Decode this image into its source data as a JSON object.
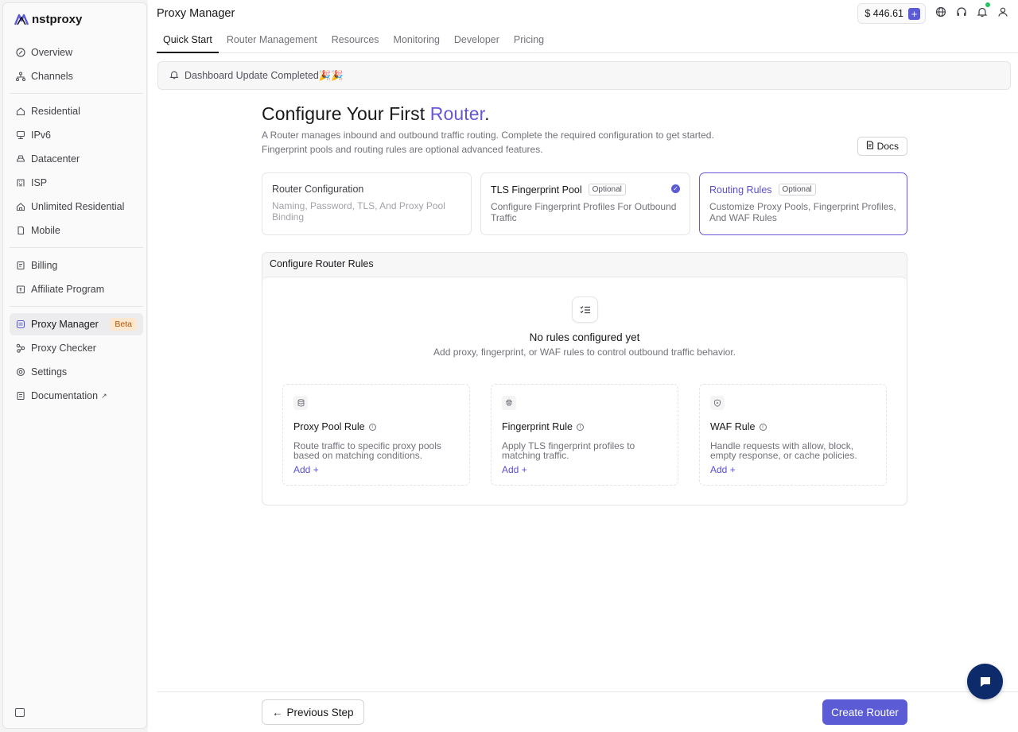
{
  "brand": {
    "name": "nstproxy"
  },
  "sidebar": {
    "group1": [
      {
        "label": "Overview",
        "icon": "overview-icon"
      },
      {
        "label": "Channels",
        "icon": "channels-icon"
      }
    ],
    "group2": [
      {
        "label": "Residential",
        "icon": "residential-icon"
      },
      {
        "label": "IPv6",
        "icon": "ipv6-icon"
      },
      {
        "label": "Datacenter",
        "icon": "datacenter-icon"
      },
      {
        "label": "ISP",
        "icon": "isp-icon"
      },
      {
        "label": "Unlimited Residential",
        "icon": "unlimited-residential-icon"
      },
      {
        "label": "Mobile",
        "icon": "mobile-icon"
      }
    ],
    "group3": [
      {
        "label": "Billing",
        "icon": "billing-icon"
      },
      {
        "label": "Affiliate Program",
        "icon": "affiliate-icon"
      }
    ],
    "group4": [
      {
        "label": "Proxy Manager",
        "icon": "proxy-manager-icon",
        "badge": "Beta"
      },
      {
        "label": "Proxy Checker",
        "icon": "proxy-checker-icon"
      },
      {
        "label": "Settings",
        "icon": "settings-icon"
      },
      {
        "label": "Documentation",
        "icon": "documentation-icon"
      }
    ]
  },
  "header": {
    "title": "Proxy Manager",
    "balance": "$ 446.61"
  },
  "tabs": [
    "Quick Start",
    "Router Management",
    "Resources",
    "Monitoring",
    "Developer",
    "Pricing"
  ],
  "notice": {
    "text": "Dashboard Update Completed🎉🎉"
  },
  "page": {
    "title_prefix": "Configure Your First ",
    "title_accent": "Router",
    "title_suffix": ".",
    "subtitle_line1": "A Router manages inbound and outbound traffic routing. Complete the required configuration to get started.",
    "subtitle_line2": "Fingerprint pools and routing rules are optional advanced features.",
    "docs_label": "Docs"
  },
  "steps": [
    {
      "title": "Router Configuration",
      "desc": "Naming, Password, TLS, And Proxy Pool Binding"
    },
    {
      "title": "TLS Fingerprint Pool",
      "optional": "Optional",
      "desc": "Configure Fingerprint Profiles For Outbound Traffic"
    },
    {
      "title": "Routing Rules",
      "optional": "Optional",
      "desc": "Customize Proxy Pools, Fingerprint Profiles, And WAF Rules"
    }
  ],
  "rules": {
    "heading": "Configure Router Rules",
    "empty_title": "No rules configured yet",
    "empty_desc": "Add proxy, fingerprint, or WAF rules to control outbound traffic behavior.",
    "cards": [
      {
        "title": "Proxy Pool Rule",
        "desc": "Route traffic to specific proxy pools based on matching conditions.",
        "add": "Add"
      },
      {
        "title": "Fingerprint Rule",
        "desc": "Apply TLS fingerprint profiles to matching traffic.",
        "add": "Add"
      },
      {
        "title": "WAF Rule",
        "desc": "Handle requests with allow, block, empty response, or cache policies.",
        "add": "Add"
      }
    ]
  },
  "footer": {
    "prev_label": "Previous Step",
    "create_label": "Create Router"
  },
  "colors": {
    "accent": "#5b5bd6",
    "badge_bg": "#fde8cf",
    "chat_fab": "#0d2a6b"
  }
}
